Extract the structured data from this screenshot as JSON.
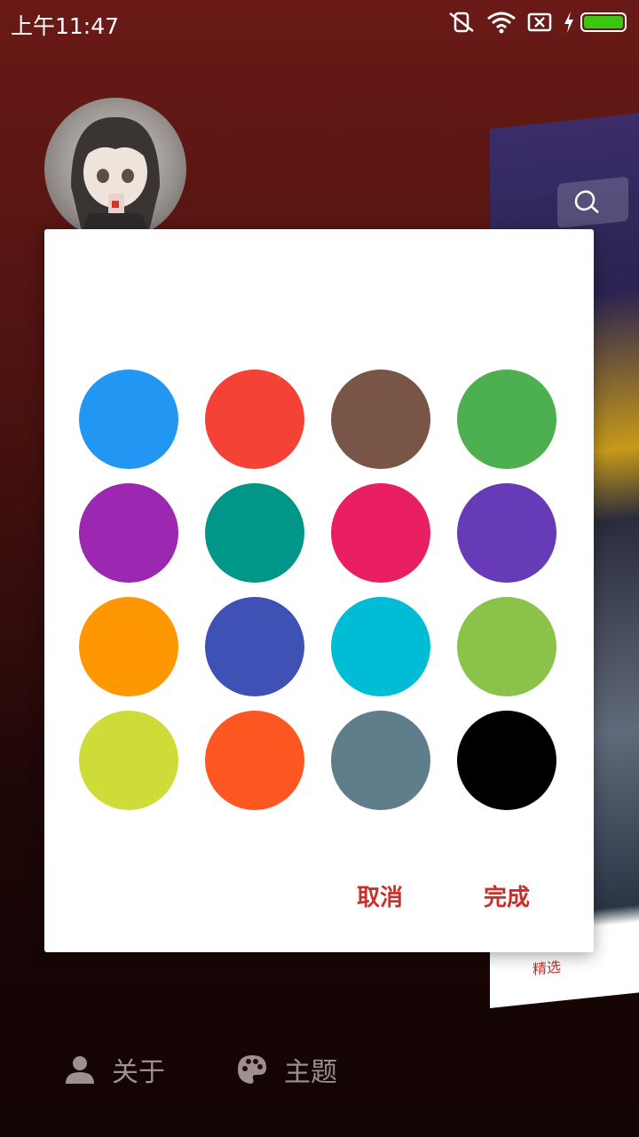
{
  "status_bar": {
    "time": "上午11:47",
    "icons": [
      "silent-icon",
      "wifi-icon",
      "sim-icon",
      "charging-icon",
      "battery-icon"
    ]
  },
  "background_card": {
    "tab_label": "精选"
  },
  "color_dialog": {
    "swatches": [
      {
        "name": "blue",
        "color": "#2196F3"
      },
      {
        "name": "red",
        "color": "#F44336"
      },
      {
        "name": "brown",
        "color": "#795548"
      },
      {
        "name": "green",
        "color": "#4CAF50"
      },
      {
        "name": "purple",
        "color": "#9C27B0"
      },
      {
        "name": "teal",
        "color": "#009688"
      },
      {
        "name": "pink",
        "color": "#E91E63"
      },
      {
        "name": "deep-purple",
        "color": "#673AB7"
      },
      {
        "name": "orange",
        "color": "#FF9800"
      },
      {
        "name": "indigo",
        "color": "#3F51B5"
      },
      {
        "name": "cyan",
        "color": "#00BCD4"
      },
      {
        "name": "light-green",
        "color": "#8BC34A"
      },
      {
        "name": "lime",
        "color": "#CDDC39"
      },
      {
        "name": "deep-orange",
        "color": "#FF5722"
      },
      {
        "name": "blue-grey",
        "color": "#607D8B"
      },
      {
        "name": "black",
        "color": "#000000"
      }
    ],
    "cancel_label": "取消",
    "done_label": "完成",
    "accent_color": "#C9302A"
  },
  "bottom_menu": {
    "about_label": "关于",
    "theme_label": "主题"
  }
}
